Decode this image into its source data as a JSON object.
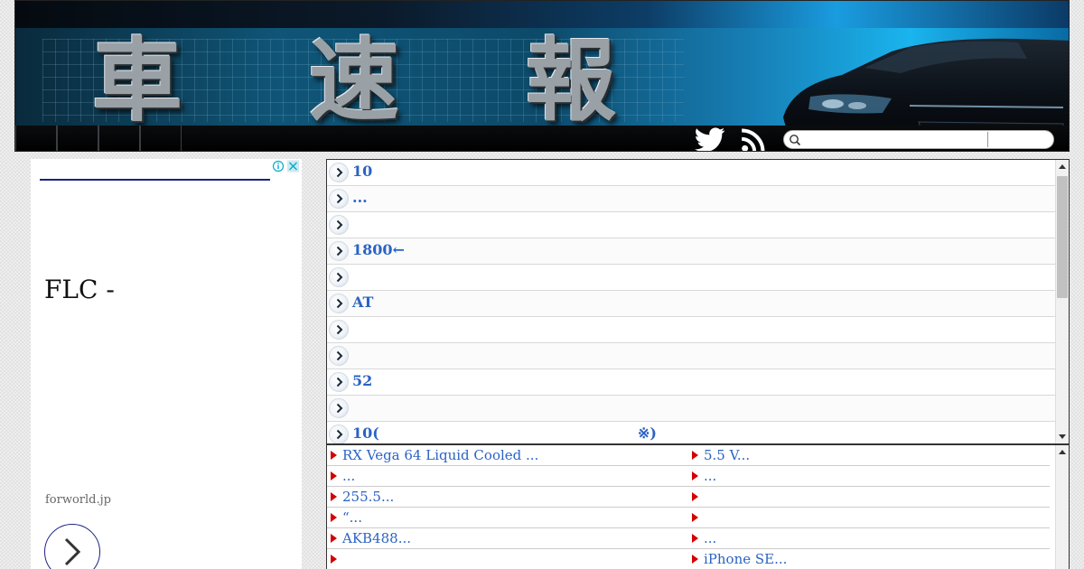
{
  "header": {
    "logo_chars": [
      "車",
      "速",
      "報"
    ],
    "search": {
      "placeholder": "",
      "value": ""
    }
  },
  "ad": {
    "headline": "FLC -",
    "domain": "forworld.jp"
  },
  "news": {
    "items": [
      {
        "text": "10"
      },
      {
        "text": "..."
      },
      {
        "text": ""
      },
      {
        "text": "1800←"
      },
      {
        "text": ""
      },
      {
        "text": "AT"
      },
      {
        "text": ""
      },
      {
        "text": ""
      },
      {
        "text": "52"
      },
      {
        "text": ""
      },
      {
        "text": "10(",
        "suffix": "※)"
      }
    ]
  },
  "links": {
    "rows": [
      {
        "left": "RX Vega 64 Liquid Cooled ...",
        "right": "5.5 V..."
      },
      {
        "left": "...",
        "right": "..."
      },
      {
        "left": " 255.5...",
        "right": ""
      },
      {
        "left": "“...",
        "right": ""
      },
      {
        "left": "AKB488...",
        "right": "..."
      },
      {
        "left": "",
        "right": "iPhone SE..."
      }
    ]
  },
  "colors": {
    "link": "#2b63c4",
    "bullet": "#d40000",
    "ad_accent": "#1a237e"
  }
}
